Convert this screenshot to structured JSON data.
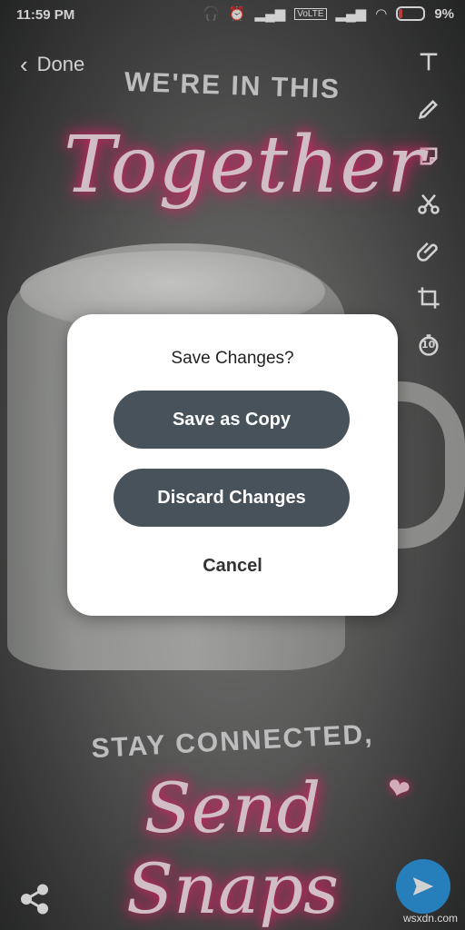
{
  "status_bar": {
    "time": "11:59 PM",
    "network_badge": "VoLTE",
    "battery_percent": "9%"
  },
  "header": {
    "done_label": "Done"
  },
  "tools": {
    "items": [
      "text-tool",
      "pencil-tool",
      "sticker-tool",
      "scissors-tool",
      "paperclip-tool",
      "crop-tool",
      "timer-tool"
    ],
    "timer_value": "10"
  },
  "sticker": {
    "top_line": "WE'RE IN THIS",
    "top_script": "Together",
    "bottom_line": "STAY CONNECTED,",
    "bottom_script": "Send Snaps"
  },
  "dialog": {
    "title": "Save Changes?",
    "save_copy_label": "Save as Copy",
    "discard_label": "Discard Changes",
    "cancel_label": "Cancel"
  },
  "watermark": "wsxdn.com",
  "colors": {
    "neon_pink": "#ff2a7a",
    "dialog_button": "#48525a",
    "send_button": "#2f9be5"
  }
}
